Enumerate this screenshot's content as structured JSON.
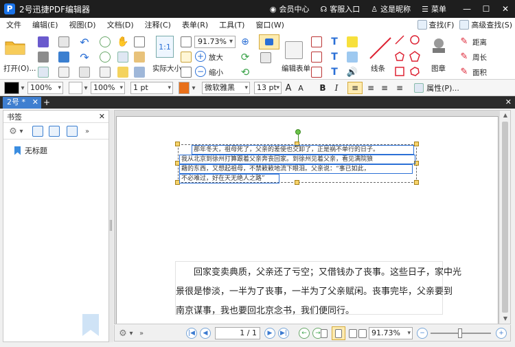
{
  "titlebar": {
    "logo": "P",
    "title": "2号迅捷PDF编辑器",
    "links": [
      {
        "icon": "user-icon",
        "glyph": "◉",
        "label": "会员中心"
      },
      {
        "icon": "headset-icon",
        "glyph": "☊",
        "label": "客服入口"
      },
      {
        "icon": "person-icon",
        "glyph": "♙",
        "label": "这是昵称"
      },
      {
        "icon": "menu-icon",
        "glyph": "☰",
        "label": "菜单"
      }
    ],
    "minimize": "—",
    "maximize": "☐",
    "close": "✕"
  },
  "menubar": {
    "items": [
      "文件",
      "编辑(E)",
      "视图(D)",
      "文档(D)",
      "注释(C)",
      "表单(R)",
      "工具(T)",
      "窗口(W)"
    ],
    "find_label": "查找(F)",
    "advanced_find_label": "高级查找(S)"
  },
  "ribbon": {
    "open_label": "打开(O)...",
    "zoom_value": "91.73%",
    "actual_size_label": "实际大小",
    "zoom_in_label": "放大",
    "zoom_out_label": "缩小",
    "edit_form_label": "编辑表单",
    "lines_label": "线条",
    "stamp_label": "图章",
    "distance_label": "距离",
    "perimeter_label": "周长",
    "area_label": "面积",
    "actual_size_glyph": "1:1"
  },
  "format": {
    "opacity1": "100%",
    "opacity2": "100%",
    "line_width": "1 pt",
    "font_name": "微软雅黑",
    "font_size": "13 pt",
    "properties_label": "属性(P)..."
  },
  "tabs": {
    "doc_tab_label": "2号 *",
    "doc_tab_close": "✕",
    "add_tab": "+",
    "close_all": "✕"
  },
  "bookmarks": {
    "title": "书签",
    "close": "✕",
    "item": "无标题"
  },
  "document": {
    "small_lines": [
      "那年冬天，祖母死了，父亲的差使也交卸了，正是祸不单行的日子。",
      "我从北京到徐州打算跟着父亲奔丧回家。到徐州见着父亲，看见满院狼",
      "藉的东西，又想起祖母，不禁簌簌地流下眼泪。父亲说：“事已如此，",
      "不必难过，好在天无绝人之路”"
    ],
    "para_lines": [
      "　　回家变卖典质，父亲还了亏空；又借钱办了丧事。这些日子，家中光",
      "景很是惨淡，一半为了丧事，一半为了父亲赋闲。丧事完毕，父亲要到",
      "南京谋事，我也要回北京念书，我们便同行。"
    ]
  },
  "bottombar": {
    "page_value": "1 / 1",
    "zoom_value": "91.73%",
    "first": "|◀",
    "prev": "◀",
    "next": "▶",
    "last": "▶|",
    "back": "←",
    "forward": "→"
  },
  "colors": {
    "accent": "#3f7fd0",
    "titlebar": "#1e1e1e",
    "handle": "#f7d36b",
    "selection": "#2a6fd6",
    "fill_orange": "#e8701a"
  }
}
